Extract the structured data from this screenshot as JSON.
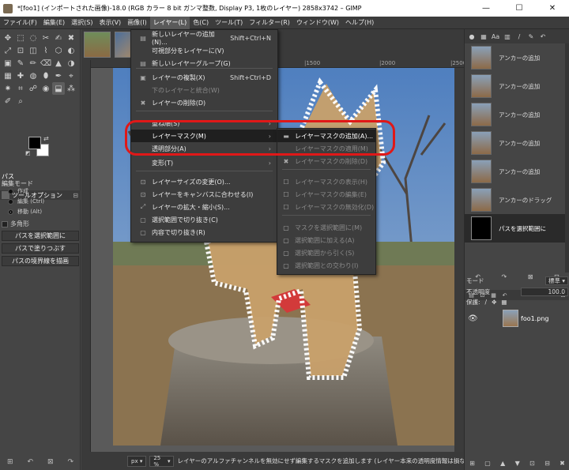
{
  "window": {
    "title": "*[foo1] (インポートされた画像)-18.0 (RGB カラー 8 bit ガンマ整数, Display P3, 1枚のレイヤー) 2858x3742 – GIMP",
    "minimize": "—",
    "maximize": "☐",
    "close": "✕"
  },
  "menubar": [
    "ファイル(F)",
    "編集(E)",
    "選択(S)",
    "表示(V)",
    "画像(I)",
    "レイヤー(L)",
    "色(C)",
    "ツール(T)",
    "フィルター(R)",
    "ウィンドウ(W)",
    "ヘルプ(H)"
  ],
  "toolbox": {
    "tool_icons": [
      "✥",
      "⬚",
      "◌",
      "✂",
      "✍",
      "✖",
      "⤢",
      "⊡",
      "◫",
      "⌇",
      "⬡",
      "◐",
      "▣",
      "✎",
      "✏",
      "⌫",
      "▲",
      "◑",
      "▦",
      "✚",
      "◍",
      "⬮",
      "✒",
      "⌖",
      "✷",
      "⌗",
      "☍",
      "◉",
      "⬓",
      "⁂",
      "✐",
      "⌕"
    ],
    "fg_color": "#000000",
    "bg_color": "#ffffff",
    "swap_icon": "⇄",
    "reset_icon": "◩",
    "options_tab_label": "ツールオプション",
    "options_config_icon": "⊟",
    "tool_name": "パス",
    "mode_label": "編集モード",
    "modes": [
      "作成",
      "編集 (Ctrl)",
      "移動 (Alt)"
    ],
    "polygon_label": "多角形",
    "buttons": [
      "パスを選択範囲に",
      "パスで塗りつぶす",
      "パスの境界線を描画"
    ],
    "bottom_icons": [
      "⊞",
      "↶",
      "⊠",
      "↷"
    ]
  },
  "ruler": {
    "marks": [
      "|1500",
      "|2000",
      "|2500"
    ]
  },
  "status": {
    "unit": "px",
    "zoom": "25 %",
    "message": "レイヤーのアルファチャンネルを無効にせず編集するマスクを追加します (レイヤー本来の透明度情報は損なわれません)"
  },
  "layer_menu": {
    "items": [
      {
        "label": "新しいレイヤーの追加(N)...",
        "shortcut": "Shift+Ctrl+N",
        "icon": "▤",
        "disabled": false
      },
      {
        "label": "可視部分をレイヤーに(V)",
        "shortcut": "",
        "icon": "",
        "disabled": false
      },
      {
        "label": "新しいレイヤーグループ(G)",
        "shortcut": "",
        "icon": "▤",
        "disabled": false
      },
      {
        "label": "レイヤーの複製(X)",
        "shortcut": "Shift+Ctrl+D",
        "icon": "▣",
        "disabled": false
      },
      {
        "label": "下のレイヤーと統合(W)",
        "shortcut": "",
        "icon": "",
        "disabled": true
      },
      {
        "label": "レイヤーの削除(D)",
        "shortcut": "",
        "icon": "✖",
        "disabled": false
      },
      {
        "label": "重ね順(S)",
        "shortcut": "",
        "icon": "",
        "disabled": false,
        "submenu": true
      },
      {
        "label": "レイヤーマスク(M)",
        "shortcut": "",
        "icon": "",
        "disabled": false,
        "submenu": true,
        "highlighted": true
      },
      {
        "label": "透明部分(A)",
        "shortcut": "",
        "icon": "",
        "disabled": false,
        "submenu": true
      },
      {
        "label": "変形(T)",
        "shortcut": "",
        "icon": "",
        "disabled": false,
        "submenu": true
      },
      {
        "label": "レイヤーサイズの変更(O)...",
        "shortcut": "",
        "icon": "⊡",
        "disabled": false
      },
      {
        "label": "レイヤーをキャンバスに合わせる(I)",
        "shortcut": "",
        "icon": "⊡",
        "disabled": false
      },
      {
        "label": "レイヤーの拡大・縮小(S)...",
        "shortcut": "",
        "icon": "⤢",
        "disabled": false
      },
      {
        "label": "選択範囲で切り抜き(C)",
        "shortcut": "",
        "icon": "▢",
        "disabled": false
      },
      {
        "label": "内容で切り抜き(R)",
        "shortcut": "",
        "icon": "▢",
        "disabled": false
      }
    ]
  },
  "mask_menu": {
    "items": [
      {
        "label": "レイヤーマスクの追加(A)...",
        "icon": "▬",
        "disabled": false,
        "highlighted": true
      },
      {
        "label": "レイヤーマスクの適用(M)",
        "icon": "",
        "disabled": true
      },
      {
        "label": "レイヤーマスクの削除(D)",
        "icon": "✖",
        "disabled": true
      },
      {
        "label": "レイヤーマスクの表示(H)",
        "icon": "☐",
        "disabled": true
      },
      {
        "label": "レイヤーマスクの編集(E)",
        "icon": "☐",
        "disabled": true
      },
      {
        "label": "レイヤーマスクの無効化(D)",
        "icon": "☐",
        "disabled": true
      },
      {
        "label": "マスクを選択範囲に(M)",
        "icon": "▢",
        "disabled": true
      },
      {
        "label": "選択範囲に加える(A)",
        "icon": "▢",
        "disabled": true
      },
      {
        "label": "選択範囲から引く(S)",
        "icon": "▢",
        "disabled": true
      },
      {
        "label": "選択範囲との交わり(I)",
        "icon": "▢",
        "disabled": true
      }
    ]
  },
  "dock": {
    "tab_icons": [
      "●",
      "▦",
      "Aa",
      "▥",
      "/",
      "✎",
      "↶"
    ],
    "history": [
      "アンカーの追加",
      "アンカーの追加",
      "アンカーの追加",
      "アンカーの追加",
      "アンカーの追加",
      "アンカーのドラッグ",
      "パスを選択範囲に"
    ],
    "history_buttons": [
      "↶",
      "↷",
      "⊠",
      "⊟"
    ],
    "layers_tab_icons": [
      "▤",
      "⊡",
      "▦",
      "↶",
      "⊟"
    ],
    "mode_label": "モード",
    "mode_value": "標準",
    "opacity_label": "不透明度",
    "opacity_value": "100.0",
    "lock_label": "保護:",
    "lock_icons": [
      "/",
      "✥",
      "▦"
    ],
    "layer_name": "foo1.png",
    "eye_icon": "👁",
    "layers_buttons": [
      "⊞",
      "▢",
      "▲",
      "▼",
      "⊡",
      "⊟",
      "✖"
    ]
  }
}
